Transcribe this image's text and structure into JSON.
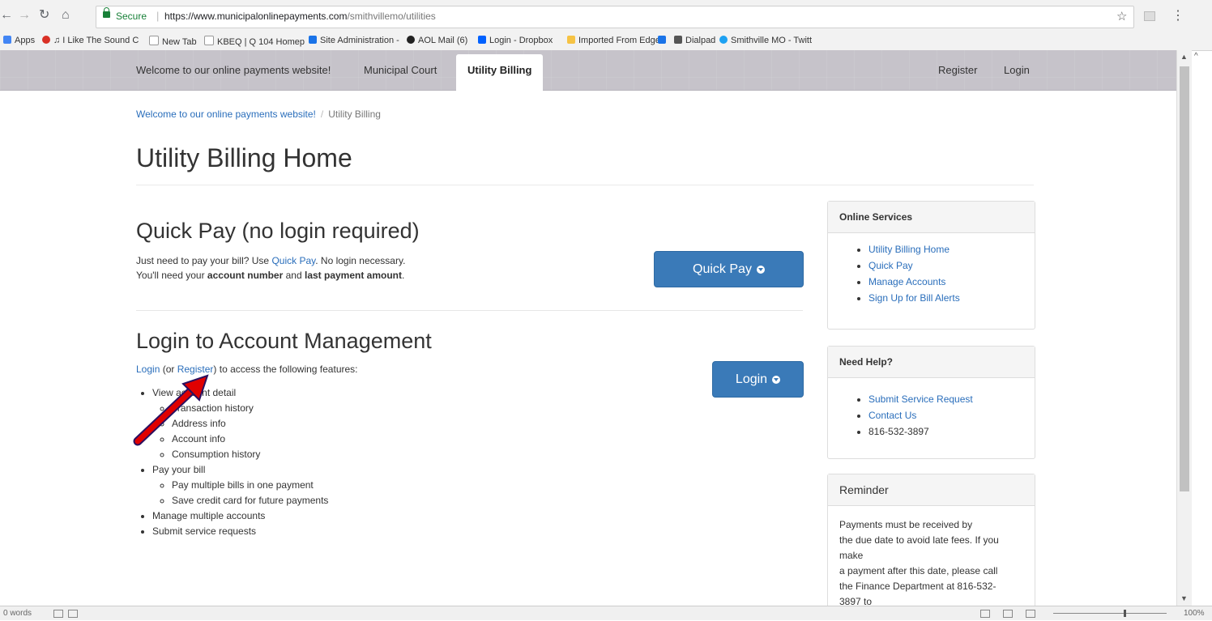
{
  "browser": {
    "secure_label": "Secure",
    "url_host": "https://www.municipalonlinepayments.com",
    "url_path": "/smithvillemo/utilities",
    "bookmarks": [
      "Apps",
      "♫ I Like The Sound C",
      "New Tab",
      "KBEQ | Q 104 Homep",
      "Site Administration -",
      "AOL Mail (6)",
      "Login - Dropbox",
      "Imported From Edge",
      "Dialpad",
      "Smithville MO - Twitt"
    ]
  },
  "nav": {
    "welcome": "Welcome to our online payments website!",
    "court": "Municipal Court",
    "utility": "Utility Billing",
    "register": "Register",
    "login": "Login"
  },
  "breadcrumb": {
    "home": "Welcome to our online payments website!",
    "separator": "/",
    "current": "Utility Billing"
  },
  "page_title": "Utility Billing Home",
  "quickpay": {
    "heading": "Quick Pay (no login required)",
    "line1_pre": "Just need to pay your bill? Use ",
    "line1_link": "Quick Pay",
    "line1_post": ". No login necessary.",
    "line2_pre": "You'll need your ",
    "line2_bold1": "account number",
    "line2_mid": " and ",
    "line2_bold2": "last payment amount",
    "line2_post": ".",
    "button": "Quick Pay"
  },
  "login": {
    "heading": "Login to Account Management",
    "link_login": "Login",
    "text_or": " (or ",
    "link_register": "Register",
    "text_post": ") to access the following features:",
    "button": "Login",
    "features": {
      "view": "View account detail",
      "transaction": "Transaction history",
      "address": "Address info",
      "account": "Account info",
      "consumption": "Consumption history",
      "pay": "Pay your bill",
      "multiple": "Pay multiple bills in one payment",
      "savecard": "Save credit card for future payments",
      "manage": "Manage multiple accounts",
      "service": "Submit service requests"
    }
  },
  "sidebar": {
    "online_title": "Online Services",
    "online_items": [
      "Utility Billing Home",
      "Quick Pay",
      "Manage Accounts",
      "Sign Up for Bill Alerts"
    ],
    "help_title": "Need Help?",
    "help_items": [
      "Submit Service Request",
      "Contact Us",
      "816-532-3897"
    ],
    "reminder_title": "Reminder",
    "reminder_lines": [
      "Payments must be received by",
      "the due date to avoid late fees. If you",
      "make",
      "a payment after this date, please call",
      "the Finance Department at 816-532-",
      "3897 to"
    ]
  },
  "statusbar": {
    "words": "0 words",
    "zoom": "100%"
  },
  "colors": {
    "primary_button": "#3a7ab8",
    "link": "#2a6ebb",
    "nav_bg": "#c6c3ca",
    "annotation_arrow": "#e00000"
  }
}
